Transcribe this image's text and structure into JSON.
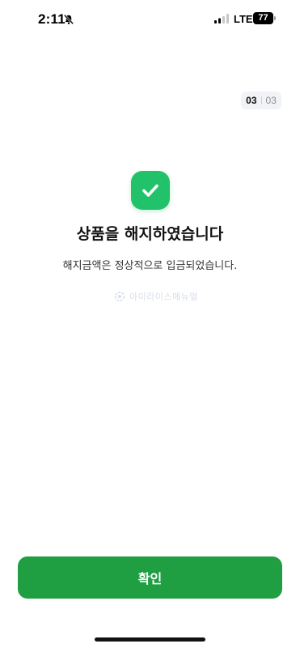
{
  "status_bar": {
    "time": "2:11",
    "network": "LTE",
    "battery": "77",
    "signal_bars": 2,
    "signal_total": 4,
    "icons": [
      "bell-off-icon",
      "signal-icon",
      "battery-icon"
    ]
  },
  "step": {
    "current": "03",
    "total": "03"
  },
  "success": {
    "icon": "check-icon",
    "title": "상품을 해지하였습니다",
    "subtitle": "해지금액은 정상적으로 입금되었습니다."
  },
  "watermark": {
    "text": "아이라이스메뉴얼"
  },
  "actions": {
    "confirm_label": "확인"
  },
  "colors": {
    "accent": "#1f9e42",
    "success": "#22c26a",
    "step_bg": "#f1f3f6"
  }
}
